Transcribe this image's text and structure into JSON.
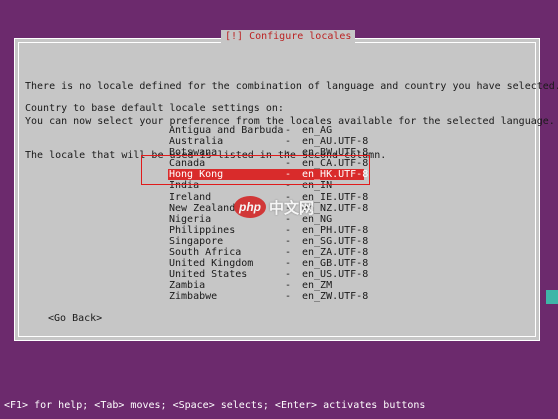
{
  "dialog": {
    "title": "[!] Configure locales",
    "description_lines": [
      "There is no locale defined for the combination of language and country you have selected.",
      "You can now select your preference from the locales available for the selected language.",
      "The locale that will be used is listed in the second column."
    ],
    "prompt": "Country to base default locale settings on:",
    "selected_index": 4,
    "locales": [
      {
        "country": "Antigua and Barbuda",
        "code": "en_AG"
      },
      {
        "country": "Australia",
        "code": "en_AU.UTF-8"
      },
      {
        "country": "Botswana",
        "code": "en_BW.UTF-8"
      },
      {
        "country": "Canada",
        "code": "en_CA.UTF-8"
      },
      {
        "country": "Hong Kong",
        "code": "en_HK.UTF-8"
      },
      {
        "country": "India",
        "code": "en_IN"
      },
      {
        "country": "Ireland",
        "code": "en_IE.UTF-8"
      },
      {
        "country": "New Zealand",
        "code": "en_NZ.UTF-8"
      },
      {
        "country": "Nigeria",
        "code": "en_NG"
      },
      {
        "country": "Philippines",
        "code": "en_PH.UTF-8"
      },
      {
        "country": "Singapore",
        "code": "en_SG.UTF-8"
      },
      {
        "country": "South Africa",
        "code": "en_ZA.UTF-8"
      },
      {
        "country": "United Kingdom",
        "code": "en_GB.UTF-8"
      },
      {
        "country": "United States",
        "code": "en_US.UTF-8"
      },
      {
        "country": "Zambia",
        "code": "en_ZM"
      },
      {
        "country": "Zimbabwe",
        "code": "en_ZW.UTF-8"
      }
    ],
    "separator": "-",
    "go_back_label": "<Go Back>"
  },
  "watermark": {
    "logo_text": "php",
    "site_text": "中文网"
  },
  "status_bar": {
    "text": "<F1> for help; <Tab> moves; <Space> selects; <Enter> activates buttons"
  },
  "colors": {
    "background": "#6c2a6d",
    "dialog": "#c6c6c6",
    "selection": "#d92b2b",
    "annotation_box": "#e01b1b"
  }
}
